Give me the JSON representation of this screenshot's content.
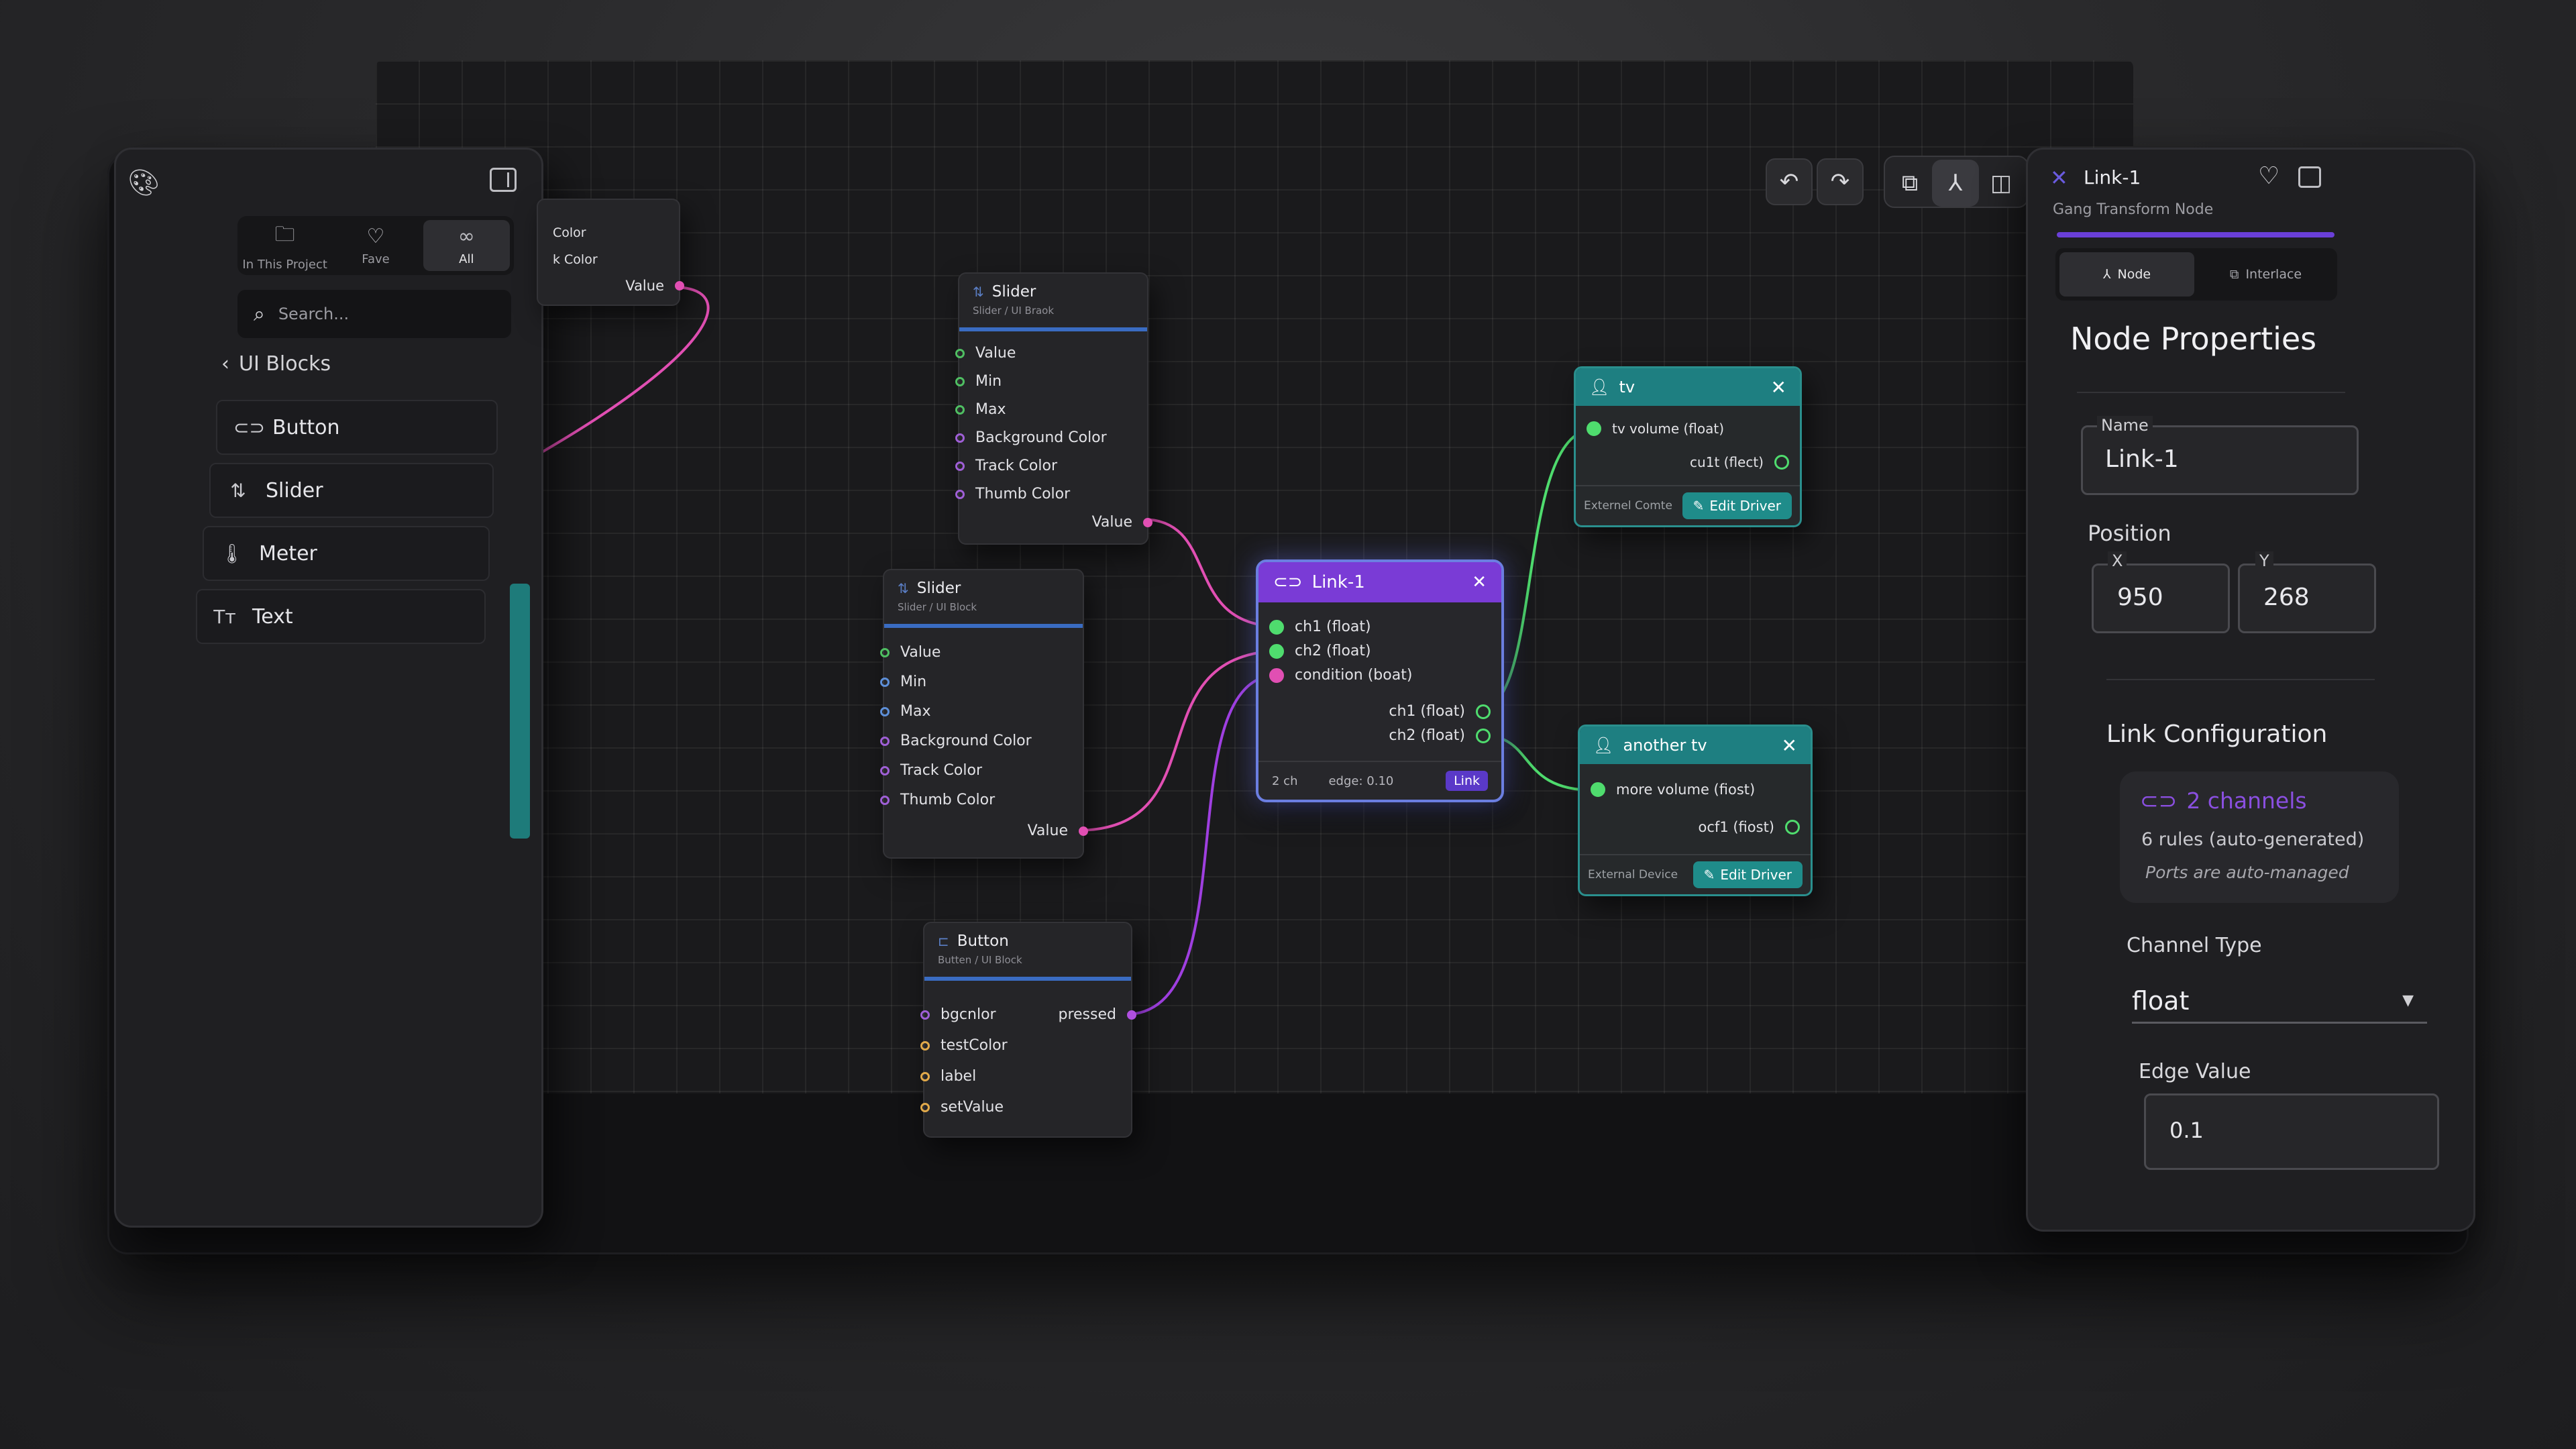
{
  "sidebar": {
    "segments": [
      {
        "label": "In This Project",
        "icon": "folder-icon"
      },
      {
        "label": "Fave",
        "icon": "heart-icon"
      },
      {
        "label": "All",
        "icon": "infinity-icon"
      }
    ],
    "search_placeholder": "Search...",
    "breadcrumb": "UI Blocks",
    "items": [
      {
        "label": "Button",
        "icon": "link-oval-icon"
      },
      {
        "label": "Slider",
        "icon": "sort-arrows-icon"
      },
      {
        "label": "Meter",
        "icon": "thermometer-icon"
      },
      {
        "label": "Text",
        "icon": "text-icon"
      }
    ]
  },
  "partial_node": {
    "rows": [
      "Color",
      "k Color"
    ],
    "output": "Value"
  },
  "slider_top": {
    "title": "Slider",
    "subtitle": "Slider / UI Braok",
    "inputs": [
      "Value",
      "Min",
      "Max",
      "Background Color",
      "Track Color",
      "Thumb Color"
    ],
    "output": "Value"
  },
  "slider_mid": {
    "title": "Slider",
    "subtitle": "Slider / UI Block",
    "inputs": [
      "Value",
      "Min",
      "Max",
      "Background Color",
      "Track Color",
      "Thumb Color"
    ],
    "output": "Value"
  },
  "button_node": {
    "title": "Button",
    "subtitle": "Butten / UI Block",
    "inputs": [
      "bgcnlor",
      "testColor",
      "label",
      "setValue"
    ],
    "output": "pressed"
  },
  "link_node": {
    "title": "Link-1",
    "inputs": [
      "ch1 (float)",
      "ch2 (float)",
      "condition (boat)"
    ],
    "outputs": [
      "ch1 (float)",
      "ch2 (float)"
    ],
    "footer_channels": "2 ch",
    "footer_edge": "edge: 0.10",
    "footer_tag": "Link"
  },
  "tv_node": {
    "title": "tv",
    "input": "tv volume (float)",
    "output": "cu1t (flect)",
    "footer": "Externel Comte",
    "button": "Edit Driver"
  },
  "tv2_node": {
    "title": "another tv",
    "input": "more volume (fiost)",
    "output": "ocf1 (fiost)",
    "footer": "External Device",
    "button": "Edit Driver"
  },
  "panel": {
    "title": "Link-1",
    "subtitle": "Gang Transform Node",
    "tabs": [
      "Node",
      "Interlace"
    ],
    "heading": "Node Properties",
    "name_label": "Name",
    "name_value": "Link-1",
    "position_label": "Position",
    "x_label": "X",
    "x_value": "950",
    "y_label": "Y",
    "y_value": "268",
    "link_config": "Link Configuration",
    "channels": "2 channels",
    "rules": "6 rules (auto-generated)",
    "ports_note": "Ports are auto-managed",
    "channel_type_label": "Channel Type",
    "channel_type_value": "float",
    "edge_label": "Edge Value",
    "edge_value": "0.1"
  },
  "colors": {
    "accent_purple": "#7a3bd6",
    "accent_teal": "#1e7f81",
    "wire_pink": "#e14fb3",
    "wire_purple": "#9f3fe0",
    "wire_green": "#4fdc6e"
  }
}
